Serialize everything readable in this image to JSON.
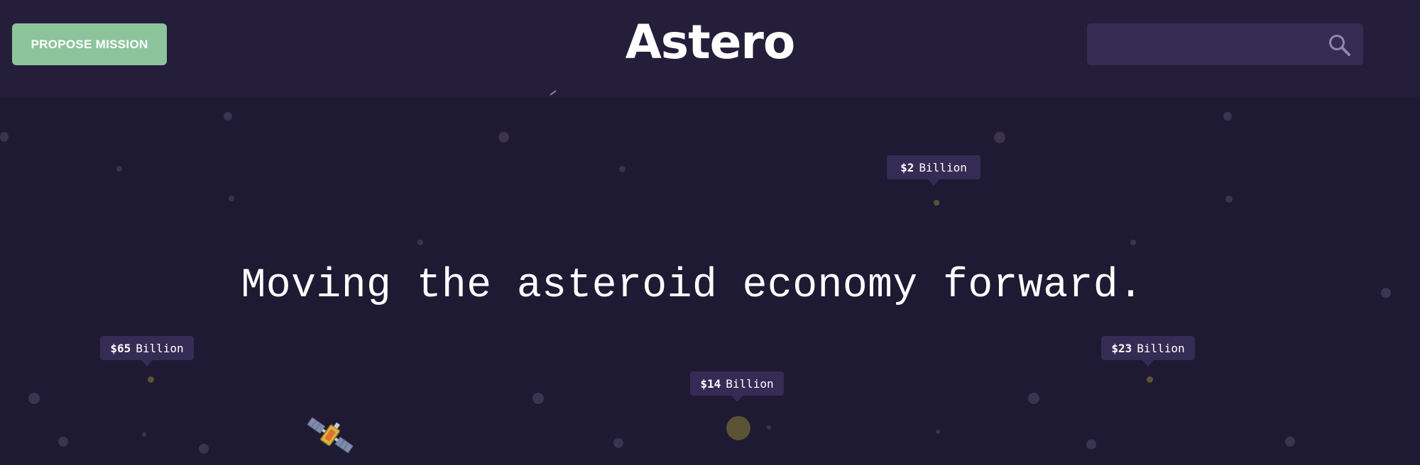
{
  "header": {
    "propose_label": "PROPOSE MISSION",
    "logo": "Astero",
    "search": {
      "placeholder": "",
      "icon": "search-icon"
    }
  },
  "hero": {
    "headline": "Moving the asteroid economy forward."
  },
  "asteroids": [
    {
      "amount": "$2",
      "unit": "Billion"
    },
    {
      "amount": "$65",
      "unit": "Billion"
    },
    {
      "amount": "$14",
      "unit": "Billion"
    },
    {
      "amount": "$23",
      "unit": "Billion"
    }
  ],
  "colors": {
    "background": "#1f1a33",
    "header": "#241e3b",
    "accent_button": "#8dc49c",
    "tag": "#352c55",
    "asteroid": "#5a5233"
  }
}
